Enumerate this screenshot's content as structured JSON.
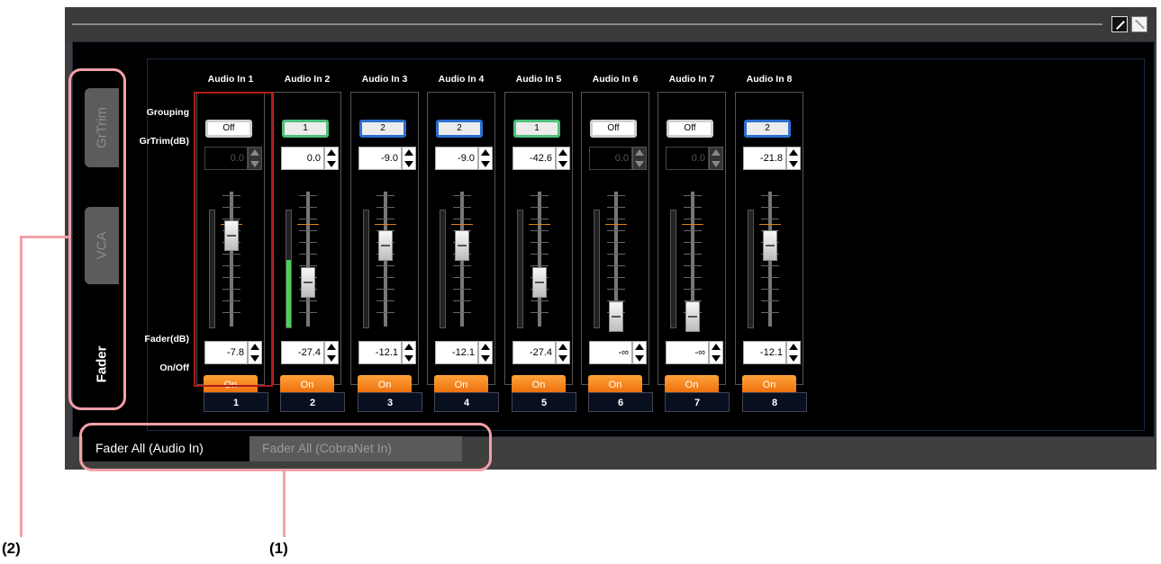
{
  "window": {
    "edit_icon": "pen-icon",
    "maximize_icon": "maximize-icon"
  },
  "side_tabs": [
    {
      "label": "GrTrim",
      "active": false
    },
    {
      "label": "VCA",
      "active": false
    },
    {
      "label": "Fader",
      "active": true
    }
  ],
  "row_labels": {
    "grouping": "Grouping",
    "grtrim": "GrTrim(dB)",
    "fader": "Fader(dB)",
    "onoff": "On/Off"
  },
  "channels": [
    {
      "name": "Audio In 1",
      "group": "Off",
      "grtrim": "0.0",
      "grtrim_enabled": false,
      "fader": "-7.8",
      "fader_level": 0.78,
      "meter_level": 0.0,
      "on": "On",
      "number": "1"
    },
    {
      "name": "Audio In 2",
      "group": "1",
      "grtrim": "0.0",
      "grtrim_enabled": true,
      "fader": "-27.4",
      "fader_level": 0.33,
      "meter_level": 0.58,
      "on": "On",
      "number": "2"
    },
    {
      "name": "Audio In 3",
      "group": "2",
      "grtrim": "-9.0",
      "grtrim_enabled": true,
      "fader": "-12.1",
      "fader_level": 0.68,
      "meter_level": 0.0,
      "on": "On",
      "number": "3"
    },
    {
      "name": "Audio In 4",
      "group": "2",
      "grtrim": "-9.0",
      "grtrim_enabled": true,
      "fader": "-12.1",
      "fader_level": 0.68,
      "meter_level": 0.0,
      "on": "On",
      "number": "4"
    },
    {
      "name": "Audio In 5",
      "group": "1",
      "grtrim": "-42.6",
      "grtrim_enabled": true,
      "fader": "-27.4",
      "fader_level": 0.33,
      "meter_level": 0.0,
      "on": "On",
      "number": "5"
    },
    {
      "name": "Audio In 6",
      "group": "Off",
      "grtrim": "0.0",
      "grtrim_enabled": false,
      "fader": "-∞",
      "fader_level": 0.0,
      "meter_level": 0.0,
      "on": "On",
      "number": "6"
    },
    {
      "name": "Audio In 7",
      "group": "Off",
      "grtrim": "0.0",
      "grtrim_enabled": false,
      "fader": "-∞",
      "fader_level": 0.0,
      "meter_level": 0.0,
      "on": "On",
      "number": "7"
    },
    {
      "name": "Audio In 8",
      "group": "2",
      "grtrim": "-21.8",
      "grtrim_enabled": true,
      "fader": "-12.1",
      "fader_level": 0.68,
      "meter_level": 0.0,
      "on": "On",
      "number": "8"
    }
  ],
  "bottom_tabs": [
    {
      "label": "Fader All (Audio In)",
      "active": true
    },
    {
      "label": "Fader All (CobraNet In)",
      "active": false
    }
  ],
  "callouts": {
    "one": "(1)",
    "two": "(2)"
  },
  "colors": {
    "accent_on": "#f07a10",
    "group1": "#4fbf7a",
    "group2": "#2c6fcf",
    "selection": "#b01a1a",
    "callout": "#f4a0a8"
  }
}
